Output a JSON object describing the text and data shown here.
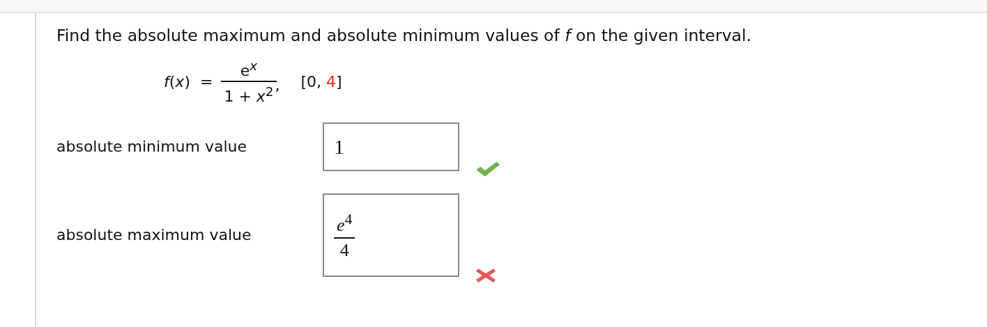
{
  "instruction": "Find the absolute maximum and absolute minimum values of *f* on the given interval.",
  "formula": {
    "lhs": "*f*(*x*)",
    "equals": "=",
    "numerator": "e$^{x}$",
    "denominator": "1 + *x*$^{2}$",
    "comma": ","
  },
  "interval": {
    "start": "[0, ",
    "end": "4",
    "close": "]"
  },
  "answers": [
    {
      "label": "absolute minimum value",
      "kind": "number",
      "value": "1",
      "correct": true
    },
    {
      "label": "absolute maximum value",
      "kind": "fraction",
      "numerator": "*e*$^{4}$",
      "denominator": "4",
      "correct": false
    }
  ]
}
